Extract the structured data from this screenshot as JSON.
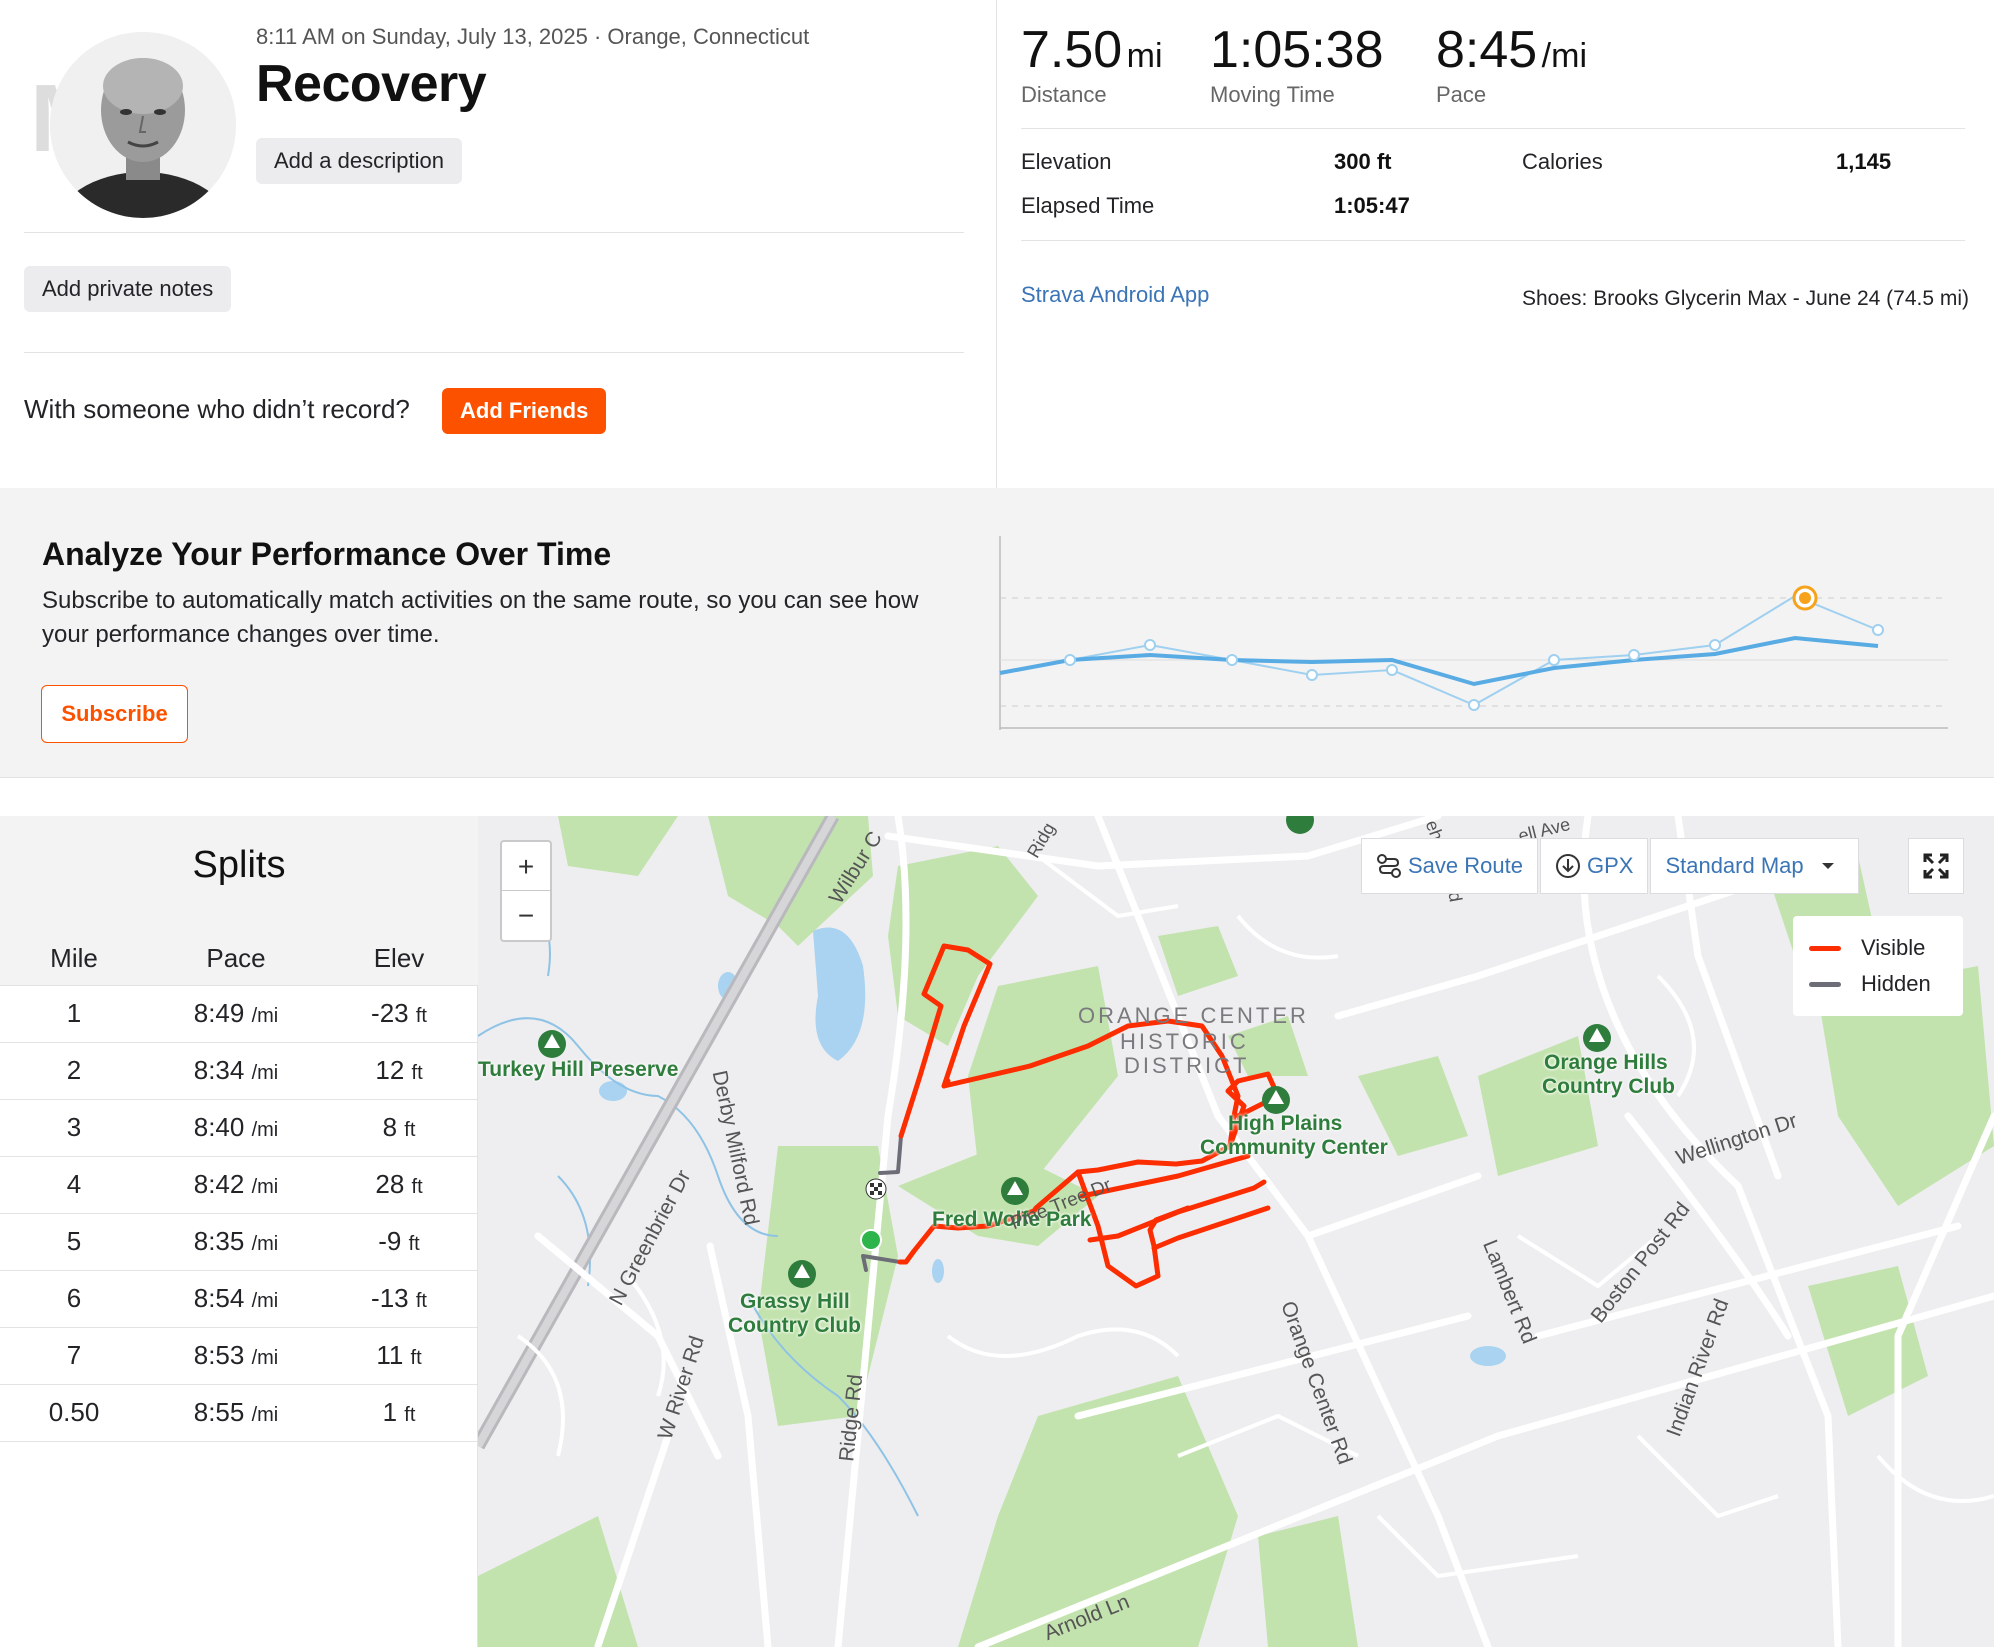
{
  "activity": {
    "meta": "8:11 AM on Sunday, July 13, 2025 · Orange, Connecticut",
    "title": "Recovery",
    "add_description": "Add a description",
    "add_private_notes": "Add private notes",
    "friends_question": "With someone who didn’t record?",
    "add_friends": "Add Friends",
    "avatar_letter": "M"
  },
  "stats": {
    "distance": {
      "value": "7.50",
      "unit": "mi",
      "label": "Distance"
    },
    "moving_time": {
      "value": "1:05:38",
      "label": "Moving Time"
    },
    "pace": {
      "value": "8:45",
      "unit": "/mi",
      "label": "Pace"
    },
    "elevation": {
      "label": "Elevation",
      "value": "300 ft"
    },
    "calories": {
      "label": "Calories",
      "value": "1,145"
    },
    "elapsed": {
      "label": "Elapsed Time",
      "value": "1:05:47"
    },
    "device": "Strava Android App",
    "shoes": "Shoes: Brooks Glycerin Max - June 24 (74.5 mi)"
  },
  "analyze": {
    "title": "Analyze Your Performance Over Time",
    "body": "Subscribe to automatically match activities on the same route, so you can see how your performance changes over time.",
    "subscribe": "Subscribe",
    "accent": "#fc5200"
  },
  "splits": {
    "title": "Splits",
    "headers": [
      "Mile",
      "Pace",
      "Elev"
    ],
    "rows": [
      {
        "mile": "1",
        "pace": "8:49",
        "pace_unit": "/mi",
        "elev": "-23",
        "elev_unit": "ft"
      },
      {
        "mile": "2",
        "pace": "8:34",
        "pace_unit": "/mi",
        "elev": "12",
        "elev_unit": "ft"
      },
      {
        "mile": "3",
        "pace": "8:40",
        "pace_unit": "/mi",
        "elev": "8",
        "elev_unit": "ft"
      },
      {
        "mile": "4",
        "pace": "8:42",
        "pace_unit": "/mi",
        "elev": "28",
        "elev_unit": "ft"
      },
      {
        "mile": "5",
        "pace": "8:35",
        "pace_unit": "/mi",
        "elev": "-9",
        "elev_unit": "ft"
      },
      {
        "mile": "6",
        "pace": "8:54",
        "pace_unit": "/mi",
        "elev": "-13",
        "elev_unit": "ft"
      },
      {
        "mile": "7",
        "pace": "8:53",
        "pace_unit": "/mi",
        "elev": "11",
        "elev_unit": "ft"
      },
      {
        "mile": "0.50",
        "pace": "8:55",
        "pace_unit": "/mi",
        "elev": "1",
        "elev_unit": "ft"
      }
    ]
  },
  "map": {
    "zoom_in": "+",
    "zoom_out": "−",
    "save_route": "Save Route",
    "gpx": "GPX",
    "map_style": "Standard Map",
    "legend": [
      {
        "label": "Visible",
        "color": "#fc2d00"
      },
      {
        "label": "Hidden",
        "color": "#6d6d78"
      }
    ],
    "labels": {
      "turkey_hill": "Turkey Hill Preserve",
      "grassy_hill_1": "Grassy Hill",
      "grassy_hill_2": "Country Club",
      "fred_wolfe": "Fred Wolfe Park",
      "high_plains_1": "High Plains",
      "high_plains_2": "Community Center",
      "orange_hills_1": "Orange Hills",
      "orange_hills_2": "Country Club",
      "district_1": "ORANGE CENTER",
      "district_2": "HISTORIC",
      "district_3": "DISTRICT",
      "wilbur": "Wilbur C",
      "derby_milford": "Derby Milford Rd",
      "n_greenbrier": "N Greenbrier Dr",
      "w_river": "W River Rd",
      "ridge_rd": "Ridge Rd",
      "orange_center": "Orange Center Rd",
      "lambert": "Lambert Rd",
      "wellington": "Wellington Dr",
      "boston_post": "Boston Post Rd",
      "indian_river": "Indian River Rd",
      "arnold": "Arnold Ln",
      "pine_tree": "Pine Tree Dr",
      "ridge_top": "Ridg",
      "russell": "ell Ave",
      "rd_top": "Rd",
      "eh": "eh"
    }
  }
}
